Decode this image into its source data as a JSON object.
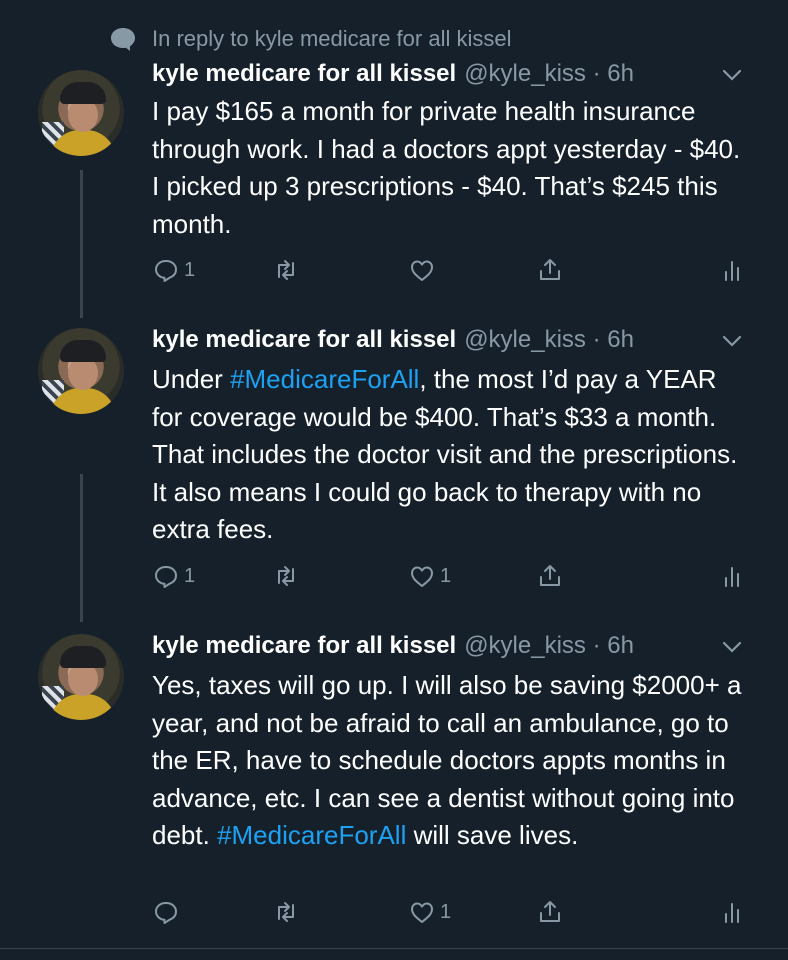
{
  "reply_context": "In reply to kyle medicare for all kissel",
  "tweets": [
    {
      "name": "kyle medicare for all kissel",
      "handle": "@kyle_kiss · 6h",
      "segments": [
        {
          "text": "I pay $165 a month for private health insurance through work. I had a doctors appt yesterday - $40. I picked up 3 prescriptions - $40. That’s $245 this month.",
          "hashtag": false
        }
      ],
      "reply_count": "1",
      "retweet_count": "",
      "like_count": "",
      "icons": [
        "reply-icon",
        "retweet-icon",
        "like-icon",
        "share-icon",
        "analytics-icon"
      ]
    },
    {
      "name": "kyle medicare for all kissel",
      "handle": "@kyle_kiss · 6h",
      "segments": [
        {
          "text": "Under ",
          "hashtag": false
        },
        {
          "text": "#MedicareForAll",
          "hashtag": true
        },
        {
          "text": ", the most I’d pay a YEAR for coverage would be $400. That’s $33 a month. That includes the doctor visit and the prescriptions. It also means I could go back to therapy with no extra fees.",
          "hashtag": false
        }
      ],
      "reply_count": "1",
      "retweet_count": "",
      "like_count": "1",
      "icons": [
        "reply-icon",
        "retweet-icon",
        "like-icon",
        "share-icon",
        "analytics-icon"
      ]
    },
    {
      "name": "kyle medicare for all kissel",
      "handle": "@kyle_kiss · 6h",
      "segments": [
        {
          "text": "Yes, taxes will go up. I will also be saving $2000+ a year, and not be afraid to call an ambulance, go to the ER, have to schedule doctors appts months in advance, etc. I can see a dentist without going into debt. ",
          "hashtag": false
        },
        {
          "text": "#MedicareForAll",
          "hashtag": true
        },
        {
          "text": " will save lives.",
          "hashtag": false
        }
      ],
      "reply_count": "",
      "retweet_count": "",
      "like_count": "1",
      "icons": [
        "reply-icon",
        "retweet-icon",
        "like-icon",
        "share-icon",
        "analytics-icon"
      ]
    }
  ],
  "colors": {
    "background": "#15202b",
    "text": "#ffffff",
    "secondary": "#8899a6",
    "hashtag": "#1da1f2",
    "line": "#38444d"
  }
}
